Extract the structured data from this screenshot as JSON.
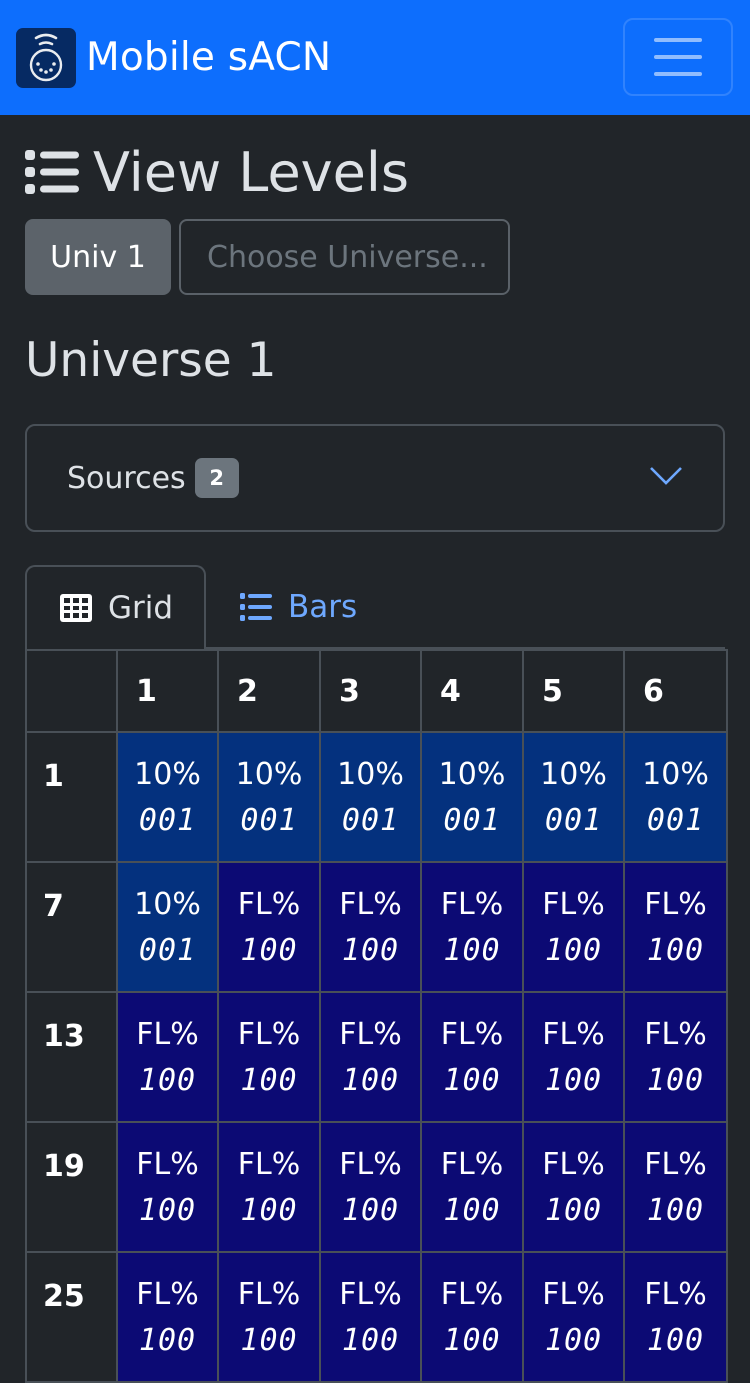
{
  "navbar": {
    "brand": "Mobile sACN",
    "logo_icon": "dmx-connector-wireless-icon",
    "toggler_icon": "hamburger-menu-icon"
  },
  "page": {
    "title": "View Levels",
    "title_icon": "list-icon"
  },
  "universe_selector": {
    "current_label": "Univ 1",
    "select_placeholder": "Choose Universe..."
  },
  "universe_heading": "Universe 1",
  "sources": {
    "label": "Sources",
    "count": "2",
    "expand_icon": "chevron-down-icon"
  },
  "tabs": [
    {
      "label": "Grid",
      "icon": "grid-icon",
      "active": true
    },
    {
      "label": "Bars",
      "icon": "list-icon",
      "active": false
    }
  ],
  "colors": {
    "level_low": "#04317e",
    "level_full": "#0c0a74",
    "accent": "#0d6efd",
    "link": "#6ea8fe"
  },
  "grid": {
    "column_headers": [
      "1",
      "2",
      "3",
      "4",
      "5",
      "6"
    ],
    "rows": [
      {
        "start": "1",
        "cells": [
          {
            "pct": "10%",
            "raw": "001",
            "level": "low"
          },
          {
            "pct": "10%",
            "raw": "001",
            "level": "low"
          },
          {
            "pct": "10%",
            "raw": "001",
            "level": "low"
          },
          {
            "pct": "10%",
            "raw": "001",
            "level": "low"
          },
          {
            "pct": "10%",
            "raw": "001",
            "level": "low"
          },
          {
            "pct": "10%",
            "raw": "001",
            "level": "low"
          }
        ]
      },
      {
        "start": "7",
        "cells": [
          {
            "pct": "10%",
            "raw": "001",
            "level": "low"
          },
          {
            "pct": "FL%",
            "raw": "100",
            "level": "full"
          },
          {
            "pct": "FL%",
            "raw": "100",
            "level": "full"
          },
          {
            "pct": "FL%",
            "raw": "100",
            "level": "full"
          },
          {
            "pct": "FL%",
            "raw": "100",
            "level": "full"
          },
          {
            "pct": "FL%",
            "raw": "100",
            "level": "full"
          }
        ]
      },
      {
        "start": "13",
        "cells": [
          {
            "pct": "FL%",
            "raw": "100",
            "level": "full"
          },
          {
            "pct": "FL%",
            "raw": "100",
            "level": "full"
          },
          {
            "pct": "FL%",
            "raw": "100",
            "level": "full"
          },
          {
            "pct": "FL%",
            "raw": "100",
            "level": "full"
          },
          {
            "pct": "FL%",
            "raw": "100",
            "level": "full"
          },
          {
            "pct": "FL%",
            "raw": "100",
            "level": "full"
          }
        ]
      },
      {
        "start": "19",
        "cells": [
          {
            "pct": "FL%",
            "raw": "100",
            "level": "full"
          },
          {
            "pct": "FL%",
            "raw": "100",
            "level": "full"
          },
          {
            "pct": "FL%",
            "raw": "100",
            "level": "full"
          },
          {
            "pct": "FL%",
            "raw": "100",
            "level": "full"
          },
          {
            "pct": "FL%",
            "raw": "100",
            "level": "full"
          },
          {
            "pct": "FL%",
            "raw": "100",
            "level": "full"
          }
        ]
      },
      {
        "start": "25",
        "cells": [
          {
            "pct": "FL%",
            "raw": "100",
            "level": "full"
          },
          {
            "pct": "FL%",
            "raw": "100",
            "level": "full"
          },
          {
            "pct": "FL%",
            "raw": "100",
            "level": "full"
          },
          {
            "pct": "FL%",
            "raw": "100",
            "level": "full"
          },
          {
            "pct": "FL%",
            "raw": "100",
            "level": "full"
          },
          {
            "pct": "FL%",
            "raw": "100",
            "level": "full"
          }
        ]
      }
    ]
  }
}
